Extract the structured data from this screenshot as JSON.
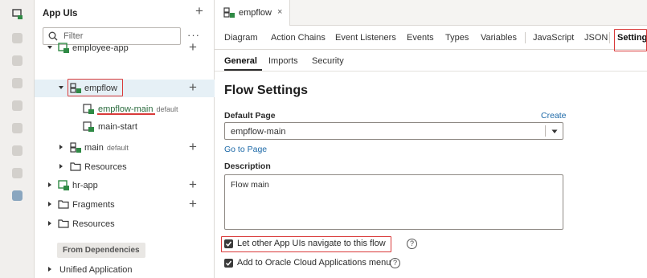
{
  "navigator": {
    "title": "App UIs",
    "filter_placeholder": "Filter",
    "more_label": "···",
    "add_label": "+",
    "tree": [
      {
        "label": "employee-app",
        "tag": ""
      },
      {
        "label": "empflow",
        "tag": ""
      },
      {
        "label": "empflow-main",
        "tag": "default"
      },
      {
        "label": "main-start",
        "tag": ""
      },
      {
        "label": "main",
        "tag": "default"
      },
      {
        "label": "Resources",
        "tag": ""
      },
      {
        "label": "hr-app",
        "tag": ""
      },
      {
        "label": "Fragments",
        "tag": ""
      },
      {
        "label": "Resources",
        "tag": ""
      }
    ],
    "from_dependencies": "From Dependencies",
    "unified_application": "Unified Application"
  },
  "file_tab": {
    "label": "empflow",
    "close": "×"
  },
  "editor_tabs": [
    "Diagram",
    "Action Chains",
    "Event Listeners",
    "Events",
    "Types",
    "Variables",
    "JavaScript",
    "JSON",
    "Settings"
  ],
  "sub_tabs": [
    "General",
    "Imports",
    "Security"
  ],
  "form": {
    "title": "Flow Settings",
    "default_page_label": "Default Page",
    "create_link": "Create",
    "default_page_value": "empflow-main",
    "go_to_page": "Go to Page",
    "description_label": "Description",
    "description_value": "Flow main",
    "checkbox_navigate": "Let other App UIs navigate to this flow",
    "checkbox_oracle_menu": "Add to Oracle Cloud Applications menu",
    "help_glyph": "?"
  },
  "colors": {
    "accent_green": "#2a6b3d",
    "highlight_red": "#d93a3a",
    "link_blue": "#1e6aa8",
    "selected_row": "#e6f0f6"
  }
}
